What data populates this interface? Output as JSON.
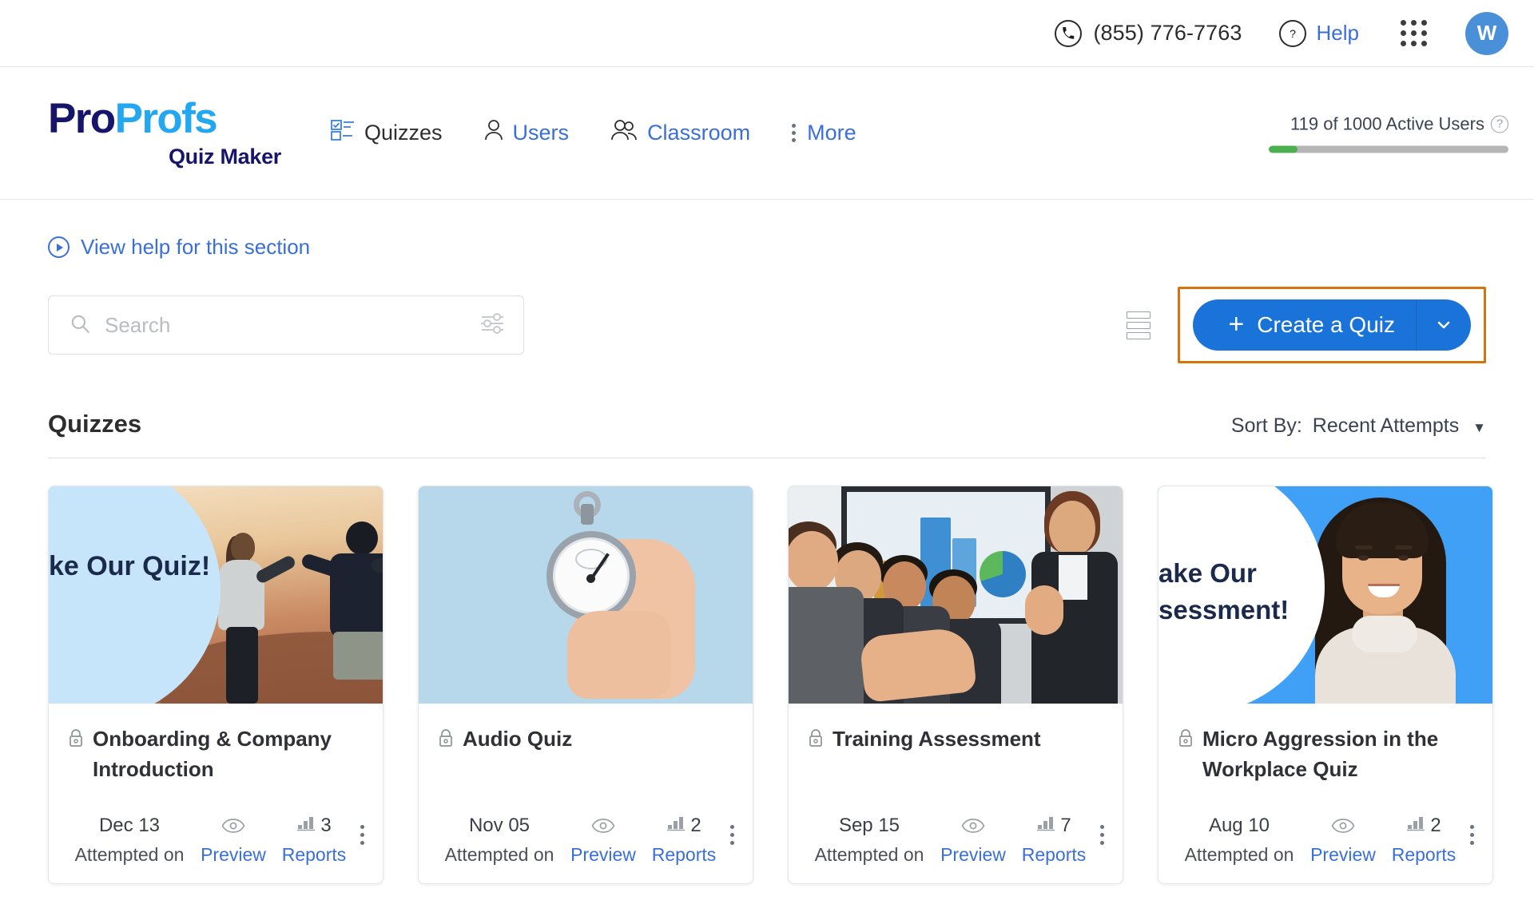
{
  "topbar": {
    "phone": "(855) 776-7763",
    "phone_icon": "phone-icon",
    "help_label": "Help",
    "help_icon": "question-circle-icon",
    "apps_icon": "apps-grid-icon",
    "avatar_initial": "W"
  },
  "brand": {
    "logo_pro": "Pro",
    "logo_profs": "Profs",
    "logo_sub": "Quiz Maker"
  },
  "nav": {
    "items": [
      {
        "label": "Quizzes",
        "icon": "quiz-list-icon",
        "active": true
      },
      {
        "label": "Users",
        "icon": "user-icon",
        "active": false
      },
      {
        "label": "Classroom",
        "icon": "group-icon",
        "active": false
      },
      {
        "label": "More",
        "icon": "vertical-dots-icon",
        "active": false
      }
    ]
  },
  "active_users": {
    "current": "119",
    "of_label": "of",
    "total": "1000",
    "suffix": "Active Users",
    "full_text": "119  of  1000 Active Users",
    "percent": 11.9,
    "bar_color": "#4caf50",
    "info_icon": "question-circle-icon"
  },
  "help_section": {
    "label": "View help for this section",
    "icon": "play-circle-icon"
  },
  "search": {
    "placeholder": "Search",
    "value": "",
    "icon": "search-icon",
    "filter_icon": "filter-sliders-icon"
  },
  "toolbar": {
    "list_view_icon": "list-view-icon",
    "create_label": "Create a Quiz",
    "create_plus": "+",
    "create_caret_icon": "chevron-down-icon",
    "highlight_color": "#d4740c",
    "button_color": "#1a73d9"
  },
  "section": {
    "title": "Quizzes",
    "sort_label": "Sort By:",
    "sort_value": "Recent Attempts",
    "sort_caret": "▼"
  },
  "cards": [
    {
      "title": "Onboarding & Company Introduction",
      "lock_icon": "lock-icon",
      "date": "Dec 13",
      "date_sub": "Attempted on",
      "preview_label": "Preview",
      "preview_icon": "eye-icon",
      "reports_label": "Reports",
      "reports_count": "3",
      "reports_icon": "bar-chart-icon",
      "menu_icon": "vertical-dots-icon",
      "thumb_text": "ke Our Quiz!",
      "thumb_kind": "sunset-friends"
    },
    {
      "title": "Audio Quiz",
      "lock_icon": "lock-icon",
      "date": "Nov 05",
      "date_sub": "Attempted on",
      "preview_label": "Preview",
      "preview_icon": "eye-icon",
      "reports_label": "Reports",
      "reports_count": "2",
      "reports_icon": "bar-chart-icon",
      "menu_icon": "vertical-dots-icon",
      "thumb_text": "",
      "thumb_kind": "stopwatch-hand"
    },
    {
      "title": "Training Assessment",
      "lock_icon": "lock-icon",
      "date": "Sep 15",
      "date_sub": "Attempted on",
      "preview_label": "Preview",
      "preview_icon": "eye-icon",
      "reports_label": "Reports",
      "reports_count": "7",
      "reports_icon": "bar-chart-icon",
      "menu_icon": "vertical-dots-icon",
      "thumb_text": "",
      "thumb_kind": "applauding-team"
    },
    {
      "title": "Micro Aggression in the Workplace Quiz",
      "lock_icon": "lock-icon",
      "date": "Aug 10",
      "date_sub": "Attempted on",
      "preview_label": "Preview",
      "preview_icon": "eye-icon",
      "reports_label": "Reports",
      "reports_count": "2",
      "reports_icon": "bar-chart-icon",
      "menu_icon": "vertical-dots-icon",
      "thumb_text": "ake Our sessment!",
      "thumb_kind": "woman-blue"
    }
  ]
}
